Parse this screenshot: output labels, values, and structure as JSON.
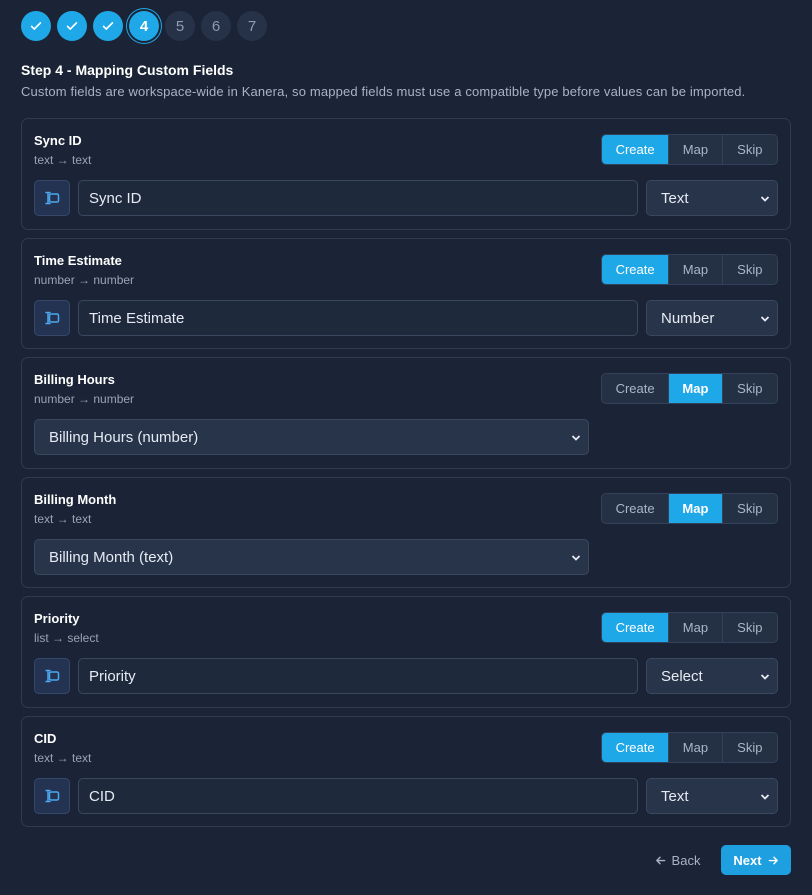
{
  "stepper": {
    "steps": [
      {
        "label": "",
        "state": "done"
      },
      {
        "label": "",
        "state": "done"
      },
      {
        "label": "",
        "state": "done"
      },
      {
        "label": "4",
        "state": "active"
      },
      {
        "label": "5",
        "state": "pending"
      },
      {
        "label": "6",
        "state": "pending"
      },
      {
        "label": "7",
        "state": "pending"
      }
    ]
  },
  "page": {
    "title": "Step 4 - Mapping Custom Fields",
    "description": "Custom fields are workspace-wide in Kanera, so mapped fields must use a compatible type before values can be imported."
  },
  "segment_labels": {
    "create": "Create",
    "map": "Map",
    "skip": "Skip"
  },
  "fields": [
    {
      "name": "Sync ID",
      "types": "text → text",
      "mode": "create",
      "input": "Sync ID",
      "type": "Text"
    },
    {
      "name": "Time Estimate",
      "types": "number → number",
      "mode": "create",
      "input": "Time Estimate",
      "type": "Number"
    },
    {
      "name": "Billing Hours",
      "types": "number → number",
      "mode": "map",
      "mapped": "Billing Hours (number)"
    },
    {
      "name": "Billing Month",
      "types": "text → text",
      "mode": "map",
      "mapped": "Billing Month (text)"
    },
    {
      "name": "Priority",
      "types": "list → select",
      "mode": "create",
      "input": "Priority",
      "type": "Select"
    },
    {
      "name": "CID",
      "types": "text → text",
      "mode": "create",
      "input": "CID",
      "type": "Text"
    }
  ],
  "footer": {
    "back_label": "Back",
    "next_label": "Next"
  },
  "colors": {
    "accent": "#1fa8e8",
    "background": "#1b2436",
    "card_border": "#2f3b51"
  }
}
